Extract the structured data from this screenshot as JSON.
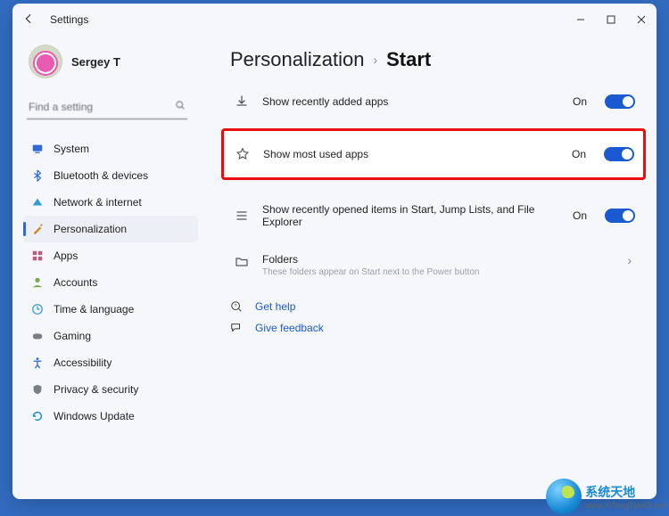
{
  "window": {
    "title": "Settings"
  },
  "profile": {
    "name": "Sergey T"
  },
  "search": {
    "placeholder": "Find a setting"
  },
  "sidebar": {
    "items": [
      {
        "label": "System",
        "icon": "system",
        "color": "#2f68d8"
      },
      {
        "label": "Bluetooth & devices",
        "icon": "bluetooth",
        "color": "#2f68d8"
      },
      {
        "label": "Network & internet",
        "icon": "network",
        "color": "#2f9cd8"
      },
      {
        "label": "Personalization",
        "icon": "personalization",
        "color": "#d08a2b",
        "selected": true
      },
      {
        "label": "Apps",
        "icon": "apps",
        "color": "#c25a7a"
      },
      {
        "label": "Accounts",
        "icon": "accounts",
        "color": "#7aa84a"
      },
      {
        "label": "Time & language",
        "icon": "time",
        "color": "#3aa0d0"
      },
      {
        "label": "Gaming",
        "icon": "gaming",
        "color": "#7a7f86"
      },
      {
        "label": "Accessibility",
        "icon": "accessibility",
        "color": "#2f68d8"
      },
      {
        "label": "Privacy & security",
        "icon": "privacy",
        "color": "#7a7f86"
      },
      {
        "label": "Windows Update",
        "icon": "update",
        "color": "#1a8ad6"
      }
    ]
  },
  "breadcrumb": {
    "parent": "Personalization",
    "current": "Start"
  },
  "settings": {
    "recentlyAdded": {
      "label": "Show recently added apps",
      "state": "On"
    },
    "mostUsed": {
      "label": "Show most used apps",
      "state": "On",
      "highlighted": true
    },
    "recentlyOpened": {
      "label": "Show recently opened items in Start, Jump Lists, and File Explorer",
      "state": "On"
    },
    "folders": {
      "label": "Folders",
      "sub": "These folders appear on Start next to the Power button"
    }
  },
  "links": {
    "help": "Get help",
    "feedback": "Give feedback"
  },
  "watermark": {
    "brand": "系统天地",
    "domain": "www.XiTongTianDi.net"
  }
}
